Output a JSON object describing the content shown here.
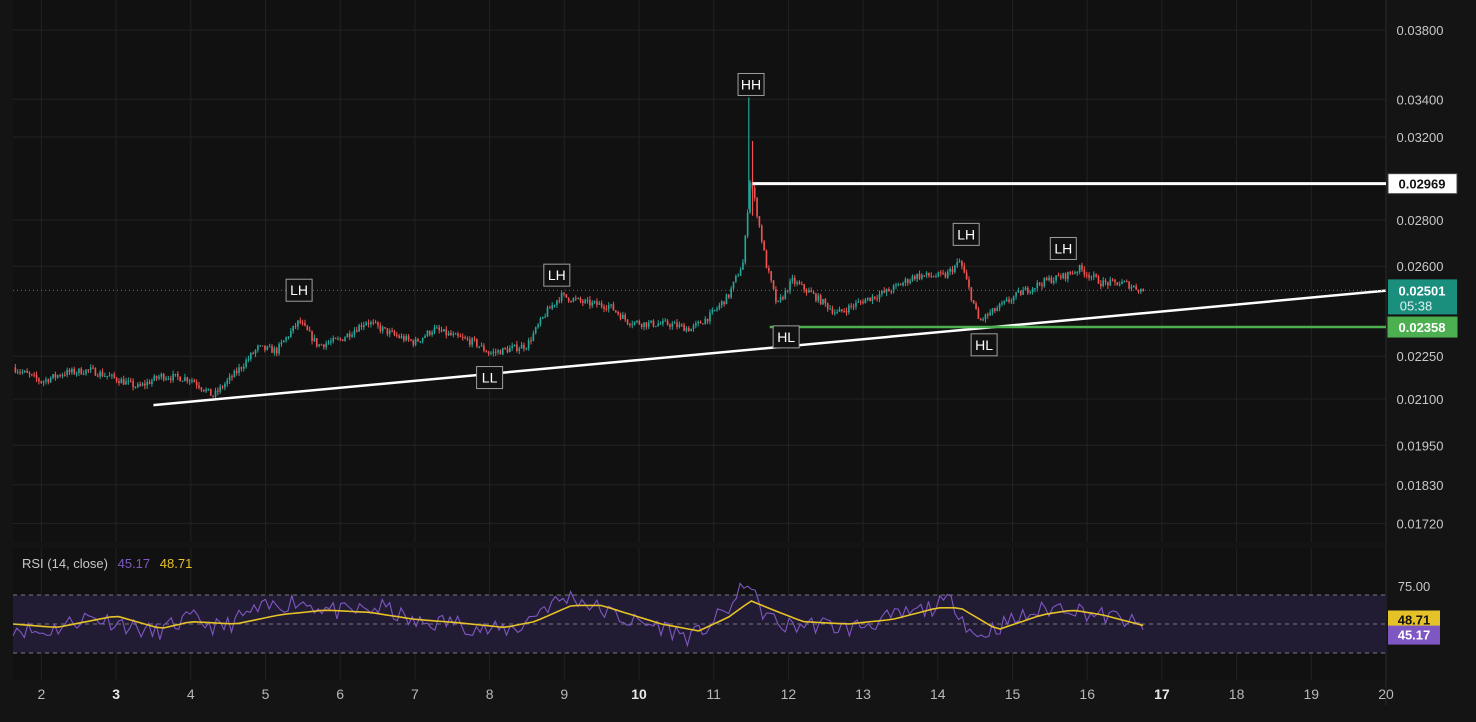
{
  "colors": {
    "background": "#141414",
    "pane": "#111111",
    "grid": "#222222",
    "up": "#26a69a",
    "down": "#ef5350",
    "trendline": "#ffffff",
    "support": "#4caf50",
    "rsi": "#7e57c2",
    "rsi_ma": "#e6c229",
    "rsi_band": "#221b34",
    "last_price_tag": "#1b8f7d",
    "label_border": "#9e9e9e"
  },
  "rsi": {
    "label": "RSI (14, close)",
    "value": "45.17",
    "ma_value": "48.71",
    "level_label": "75.00",
    "upper": 75,
    "middle": 50,
    "lower": 25,
    "ylim": [
      0,
      100
    ]
  },
  "price_axis": {
    "tick_labels": [
      "0.03800",
      "0.03400",
      "0.03200",
      "0.02800",
      "0.02600",
      "0.02250",
      "0.02100",
      "0.01950",
      "0.01830",
      "0.01720"
    ],
    "tick_values": [
      0.038,
      0.034,
      0.032,
      0.028,
      0.026,
      0.0225,
      0.021,
      0.0195,
      0.0183,
      0.0172
    ],
    "resistance_label": "0.02969",
    "support_label": "0.02358",
    "last_price_label": "0.02501",
    "countdown": "05:38"
  },
  "time_axis": {
    "labels": [
      "2",
      "3",
      "4",
      "5",
      "6",
      "7",
      "8",
      "9",
      "10",
      "11",
      "12",
      "13",
      "14",
      "15",
      "16",
      "17",
      "18",
      "19",
      "20"
    ],
    "values": [
      2,
      3,
      4,
      5,
      6,
      7,
      8,
      9,
      10,
      11,
      12,
      13,
      14,
      15,
      16,
      17,
      18,
      19,
      20
    ],
    "bold": [
      "3",
      "10",
      "17"
    ]
  },
  "chart_data": {
    "type": "candlestick",
    "xlabel": "",
    "ylabel": "",
    "x_range": [
      1.62,
      20.0
    ],
    "y_scale": "log",
    "ylim": [
      0.0168,
      0.0395
    ],
    "grid": true,
    "close_path": [
      [
        1.62,
        0.0221
      ],
      [
        2.0,
        0.0216
      ],
      [
        2.3,
        0.0219
      ],
      [
        2.65,
        0.022
      ],
      [
        3.0,
        0.0217
      ],
      [
        3.3,
        0.0214
      ],
      [
        3.6,
        0.0218
      ],
      [
        4.0,
        0.0217
      ],
      [
        4.3,
        0.0211
      ],
      [
        4.6,
        0.0219
      ],
      [
        4.9,
        0.0228
      ],
      [
        5.15,
        0.0227
      ],
      [
        5.45,
        0.0238
      ],
      [
        5.7,
        0.0229
      ],
      [
        6.0,
        0.0231
      ],
      [
        6.35,
        0.0238
      ],
      [
        6.7,
        0.0233
      ],
      [
        7.0,
        0.023
      ],
      [
        7.25,
        0.0235
      ],
      [
        7.55,
        0.0232
      ],
      [
        7.8,
        0.023
      ],
      [
        8.0,
        0.0226
      ],
      [
        8.5,
        0.0229
      ],
      [
        8.75,
        0.0241
      ],
      [
        8.95,
        0.0248
      ],
      [
        9.3,
        0.0245
      ],
      [
        9.6,
        0.0244
      ],
      [
        9.85,
        0.0238
      ],
      [
        10.1,
        0.0237
      ],
      [
        10.4,
        0.0237
      ],
      [
        10.7,
        0.0235
      ],
      [
        10.95,
        0.024
      ],
      [
        11.2,
        0.0248
      ],
      [
        11.4,
        0.0262
      ],
      [
        11.49,
        0.03
      ],
      [
        11.56,
        0.0287
      ],
      [
        11.7,
        0.0261
      ],
      [
        11.85,
        0.0244
      ],
      [
        12.05,
        0.0254
      ],
      [
        12.3,
        0.0249
      ],
      [
        12.65,
        0.0241
      ],
      [
        13.0,
        0.0246
      ],
      [
        13.35,
        0.025
      ],
      [
        13.7,
        0.0256
      ],
      [
        14.1,
        0.0256
      ],
      [
        14.3,
        0.0262
      ],
      [
        14.55,
        0.0238
      ],
      [
        14.8,
        0.0243
      ],
      [
        15.1,
        0.0249
      ],
      [
        15.45,
        0.0254
      ],
      [
        15.7,
        0.0256
      ],
      [
        15.9,
        0.0259
      ],
      [
        16.2,
        0.0253
      ],
      [
        16.5,
        0.0253
      ],
      [
        16.75,
        0.025
      ]
    ],
    "trendline": {
      "start": [
        3.5,
        0.0208
      ],
      "end": [
        20.0,
        0.025
      ]
    },
    "resistance": {
      "value": 0.02969,
      "from_x": 11.52
    },
    "support": {
      "value": 0.02358,
      "from_x": 11.75
    },
    "last_price": 0.02501,
    "swing_labels": [
      {
        "text": "LH",
        "x": 5.45,
        "y": 0.0245,
        "above": true
      },
      {
        "text": "LL",
        "x": 8.0,
        "y": 0.0222,
        "above": false
      },
      {
        "text": "LH",
        "x": 8.9,
        "y": 0.0251,
        "above": true
      },
      {
        "text": "HH",
        "x": 11.5,
        "y": 0.0341,
        "above": true
      },
      {
        "text": "HL",
        "x": 11.97,
        "y": 0.0237,
        "above": false
      },
      {
        "text": "LH",
        "x": 14.38,
        "y": 0.0268,
        "above": true
      },
      {
        "text": "HL",
        "x": 14.62,
        "y": 0.0234,
        "above": false
      },
      {
        "text": "LH",
        "x": 15.68,
        "y": 0.0262,
        "above": true
      }
    ],
    "rsi_path": [
      [
        1.62,
        48
      ],
      [
        2.0,
        42
      ],
      [
        2.6,
        56
      ],
      [
        3.0,
        52
      ],
      [
        3.5,
        42
      ],
      [
        4.0,
        55
      ],
      [
        4.4,
        46
      ],
      [
        4.8,
        60
      ],
      [
        5.4,
        70
      ],
      [
        6.0,
        60
      ],
      [
        6.6,
        64
      ],
      [
        7.0,
        50
      ],
      [
        7.5,
        52
      ],
      [
        8.0,
        44
      ],
      [
        8.4,
        47
      ],
      [
        8.7,
        64
      ],
      [
        9.1,
        74
      ],
      [
        9.5,
        62
      ],
      [
        9.9,
        52
      ],
      [
        10.3,
        48
      ],
      [
        10.7,
        38
      ],
      [
        11.0,
        52
      ],
      [
        11.3,
        70
      ],
      [
        11.45,
        90
      ],
      [
        11.6,
        64
      ],
      [
        11.9,
        48
      ],
      [
        12.4,
        50
      ],
      [
        12.8,
        46
      ],
      [
        13.3,
        54
      ],
      [
        13.8,
        62
      ],
      [
        14.2,
        70
      ],
      [
        14.5,
        38
      ],
      [
        14.8,
        48
      ],
      [
        15.3,
        60
      ],
      [
        15.7,
        66
      ],
      [
        16.1,
        58
      ],
      [
        16.5,
        54
      ],
      [
        16.75,
        45.17
      ]
    ],
    "rsi_ma_path": [
      [
        1.62,
        50
      ],
      [
        2.2,
        47
      ],
      [
        3.0,
        57
      ],
      [
        3.6,
        46
      ],
      [
        4.0,
        52
      ],
      [
        4.6,
        50
      ],
      [
        5.2,
        58
      ],
      [
        5.8,
        62
      ],
      [
        6.4,
        60
      ],
      [
        7.0,
        54
      ],
      [
        7.6,
        51
      ],
      [
        8.2,
        47
      ],
      [
        8.6,
        52
      ],
      [
        9.1,
        66
      ],
      [
        9.5,
        66
      ],
      [
        9.9,
        58
      ],
      [
        10.3,
        50
      ],
      [
        10.8,
        44
      ],
      [
        11.2,
        56
      ],
      [
        11.5,
        70
      ],
      [
        11.8,
        62
      ],
      [
        12.2,
        52
      ],
      [
        12.8,
        50
      ],
      [
        13.4,
        54
      ],
      [
        14.0,
        64
      ],
      [
        14.3,
        64
      ],
      [
        14.8,
        45
      ],
      [
        15.4,
        58
      ],
      [
        15.8,
        62
      ],
      [
        16.2,
        58
      ],
      [
        16.75,
        48.71
      ]
    ]
  }
}
